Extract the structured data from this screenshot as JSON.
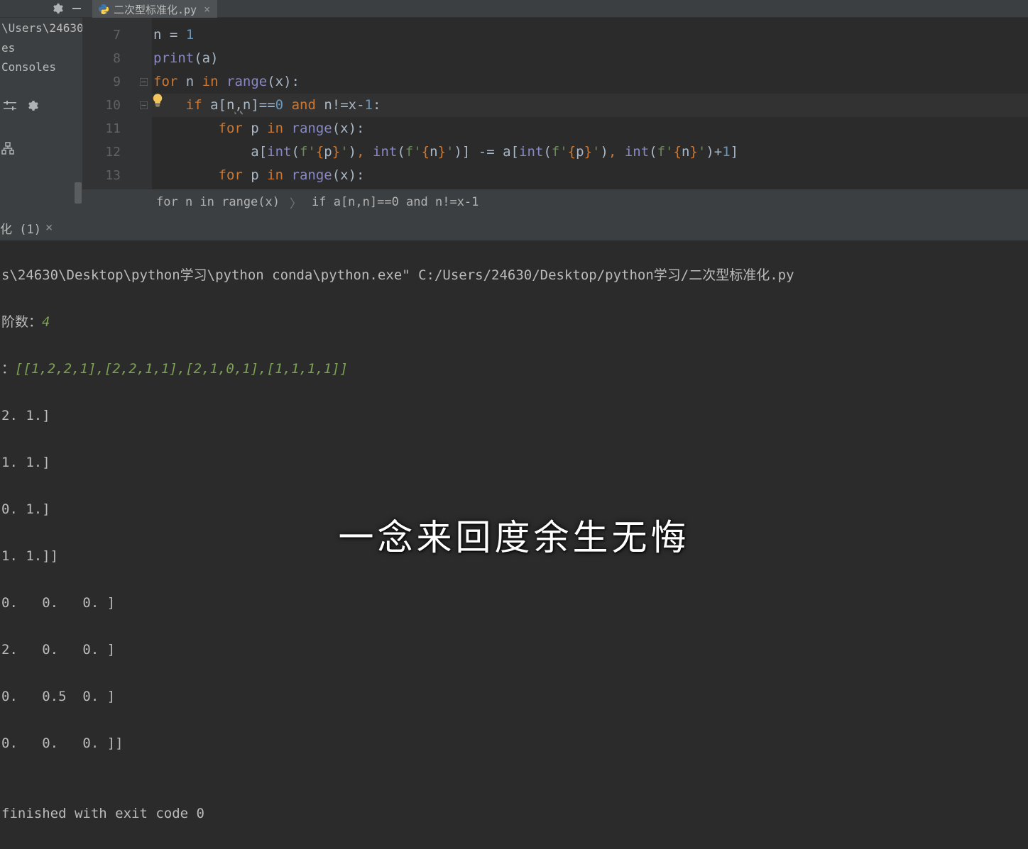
{
  "tab": {
    "filename": "二次型标准化.py"
  },
  "gutter": [
    "7",
    "8",
    "9",
    "10",
    "11",
    "12",
    "13"
  ],
  "left": {
    "path": "\\Users\\24630",
    "item1": "es",
    "item2": "Consoles"
  },
  "code": {
    "l7": {
      "pre": "n = ",
      "num": "1"
    },
    "l8": {
      "fn": "print",
      "rest": "(a)"
    },
    "l9": {
      "k1": "for",
      "mid": " n ",
      "k2": "in",
      "sp": " ",
      "fn": "range",
      "rest": "(x):"
    },
    "l10": {
      "pad": "    ",
      "k1": "if ",
      "a": "a[n",
      "comma": ",",
      "n2": "n]",
      "eq": "==",
      "zero": "0",
      "sp": " ",
      "k2": "and ",
      "ne": "n!=x-",
      "one": "1",
      "colon": ":"
    },
    "l11": {
      "pad": "        ",
      "k1": "for",
      "mid": " p ",
      "k2": "in",
      "sp": " ",
      "fn": "range",
      "rest": "(x):"
    },
    "l12": {
      "pad": "            ",
      "t1": "a[",
      "fn1": "int",
      "p1": "(",
      "f1": "f'",
      "b1": "{",
      "v1": "p",
      "b2": "}",
      "q1": "'",
      "p2": ")",
      "c1": ", ",
      "fn2": "int",
      "p3": "(",
      "f2": "f'",
      "b3": "{",
      "v2": "n",
      "b4": "}",
      "q2": "'",
      "p4": ")] -= a[",
      "fn3": "int",
      "p5": "(",
      "f3": "f'",
      "b5": "{",
      "v3": "p",
      "b6": "}",
      "q3": "'",
      "p6": ")",
      "c2": ", ",
      "fn4": "int",
      "p7": "(",
      "f4": "f'",
      "b7": "{",
      "v4": "n",
      "b8": "}",
      "q4": "'",
      "p8": ")+",
      "one": "1",
      "end": "]"
    },
    "l13": {
      "pad": "        ",
      "k1": "for",
      "mid": " p ",
      "k2": "in",
      "sp": " ",
      "fn": "range",
      "rest": "(x):"
    }
  },
  "breadcrumb": {
    "a": "for n in range(x)",
    "b": "if a[n,n]==0 and n!=x-1"
  },
  "runtab": {
    "label": "化 (1)"
  },
  "console": {
    "l1": "s\\24630\\Desktop\\python学习\\python conda\\python.exe\" C:/Users/24630/Desktop/python学习/二次型标准化.py",
    "l2a": "阶数：",
    "l2b": "4",
    "l3a": "：",
    "l3b": "[[1,2,2,1],[2,2,1,1],[2,1,0,1],[1,1,1,1]]",
    "l4": "2. 1.]",
    "l5": "1. 1.]",
    "l6": "0. 1.]",
    "l7": "1. 1.]]",
    "l8": "0.   0.   0. ]",
    "l9": "2.   0.   0. ]",
    "l10": "0.   0.5  0. ]",
    "l11": "0.   0.   0. ]]",
    "l12": "",
    "l13": "finished with exit code 0"
  },
  "subtitle": "一念来回度余生无悔"
}
